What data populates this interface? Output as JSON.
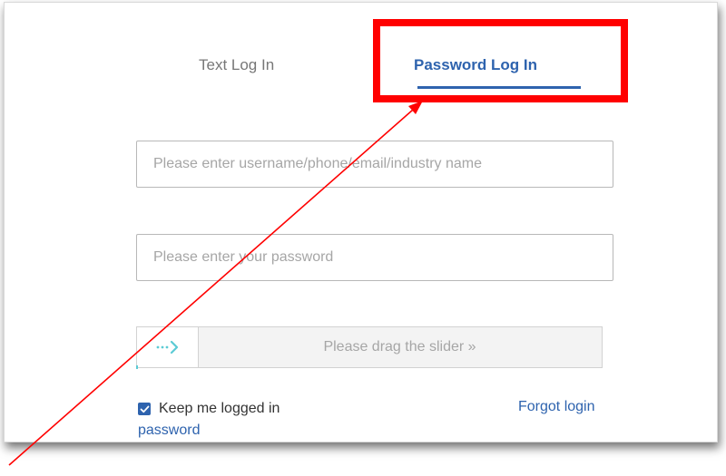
{
  "tabs": {
    "text_login": "Text Log In",
    "password_login": "Password Log In",
    "active": "password_login"
  },
  "form": {
    "username_placeholder": "Please enter username/phone/email/industry name",
    "username_value": "",
    "password_placeholder": "Please enter your password",
    "password_value": ""
  },
  "slider": {
    "label": "Please drag the slider »",
    "handle_icon": "dotted-arrow-right-icon",
    "progress": 0
  },
  "options": {
    "keep_logged_in_label": "Keep me logged in",
    "keep_logged_in_checked": true,
    "forgot_label_line1": "Forgot login",
    "forgot_label_line2": "password"
  },
  "annotation": {
    "highlight_color": "#ff0000",
    "arrow_color": "#ff0000"
  },
  "colors": {
    "accent": "#2e63ae",
    "slider_accent": "#5ccbd5"
  }
}
